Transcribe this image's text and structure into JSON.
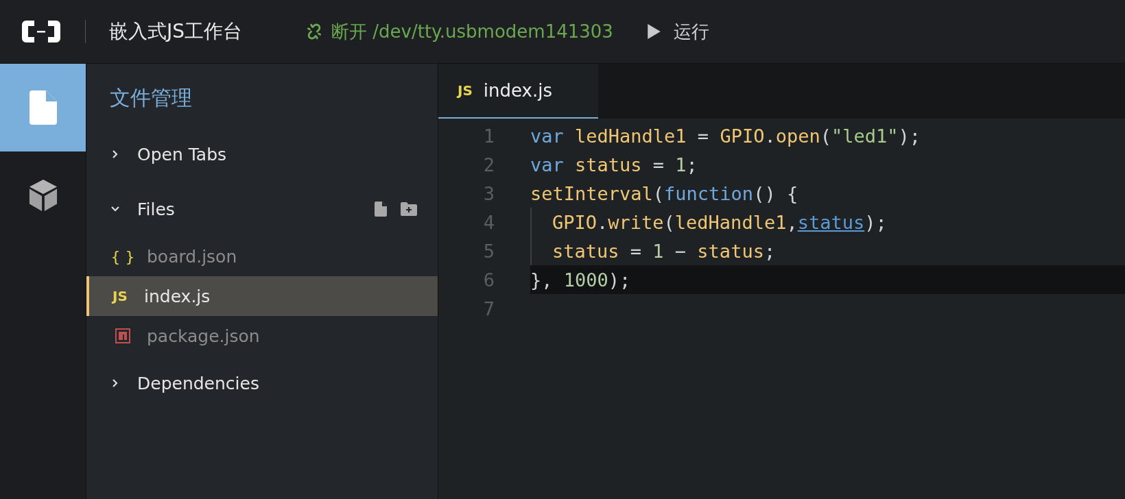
{
  "header": {
    "title": "嵌入式JS工作台",
    "connection": {
      "label": "断开 /dev/tty.usbmodem141303",
      "connected": true
    },
    "run_label": "运行"
  },
  "activity_bar": [
    {
      "kind": "files",
      "selected": true
    },
    {
      "kind": "packages",
      "selected": false
    }
  ],
  "sidebar": {
    "title": "文件管理",
    "sections": [
      {
        "label": "Open Tabs",
        "expanded": false
      },
      {
        "label": "Files",
        "expanded": true,
        "actions": [
          {
            "kind": "new-file"
          },
          {
            "kind": "new-folder"
          }
        ],
        "files": [
          {
            "name": "board.json",
            "kind": "json",
            "icon": "{ }",
            "selected": false
          },
          {
            "name": "index.js",
            "kind": "js",
            "icon": "JS",
            "selected": true
          },
          {
            "name": "package.json",
            "kind": "npm",
            "selected": false
          }
        ]
      },
      {
        "label": "Dependencies",
        "expanded": false
      }
    ]
  },
  "editor": {
    "tabs": [
      {
        "label": "index.js",
        "kind": "js",
        "icon": "JS",
        "selected": true
      }
    ],
    "lines": [
      {
        "number": "1",
        "indented": false,
        "current": false,
        "tokens": [
          {
            "text": "var",
            "kind": "keyword"
          },
          {
            "text": " ledHandle1 ",
            "kind": "ident"
          },
          {
            "text": "=",
            "kind": "punct"
          },
          {
            "text": " GPIO",
            "kind": "ident"
          },
          {
            "text": ".",
            "kind": "punct"
          },
          {
            "text": "open",
            "kind": "ident"
          },
          {
            "text": "(",
            "kind": "punct"
          },
          {
            "text": "\"led1\"",
            "kind": "string"
          },
          {
            "text": ");",
            "kind": "punct"
          }
        ]
      },
      {
        "number": "2",
        "indented": false,
        "current": false,
        "tokens": [
          {
            "text": "var",
            "kind": "keyword"
          },
          {
            "text": " status ",
            "kind": "ident"
          },
          {
            "text": "= ",
            "kind": "punct"
          },
          {
            "text": "1",
            "kind": "number"
          },
          {
            "text": ";",
            "kind": "punct"
          }
        ]
      },
      {
        "number": "3",
        "indented": false,
        "current": false,
        "tokens": [
          {
            "text": "setInterval",
            "kind": "ident"
          },
          {
            "text": "(",
            "kind": "punct"
          },
          {
            "text": "function",
            "kind": "keyword"
          },
          {
            "text": "() {",
            "kind": "punct"
          }
        ]
      },
      {
        "number": "4",
        "indented": true,
        "current": false,
        "tokens": [
          {
            "text": "GPIO",
            "kind": "ident"
          },
          {
            "text": ".",
            "kind": "punct"
          },
          {
            "text": "write",
            "kind": "ident"
          },
          {
            "text": "(",
            "kind": "punct"
          },
          {
            "text": "ledHandle1",
            "kind": "ident"
          },
          {
            "text": ",",
            "kind": "punct"
          },
          {
            "text": "status",
            "kind": "link"
          },
          {
            "text": ");",
            "kind": "punct"
          }
        ]
      },
      {
        "number": "5",
        "indented": true,
        "current": false,
        "tokens": [
          {
            "text": "status ",
            "kind": "ident"
          },
          {
            "text": "= ",
            "kind": "punct"
          },
          {
            "text": "1",
            "kind": "number"
          },
          {
            "text": " − ",
            "kind": "punct"
          },
          {
            "text": "status",
            "kind": "ident"
          },
          {
            "text": ";",
            "kind": "punct"
          }
        ]
      },
      {
        "number": "6",
        "indented": false,
        "current": true,
        "tokens": [
          {
            "text": "}, ",
            "kind": "punct"
          },
          {
            "text": "1000",
            "kind": "number"
          },
          {
            "text": ");",
            "kind": "punct"
          }
        ]
      },
      {
        "number": "7",
        "indented": false,
        "current": false
      }
    ]
  }
}
